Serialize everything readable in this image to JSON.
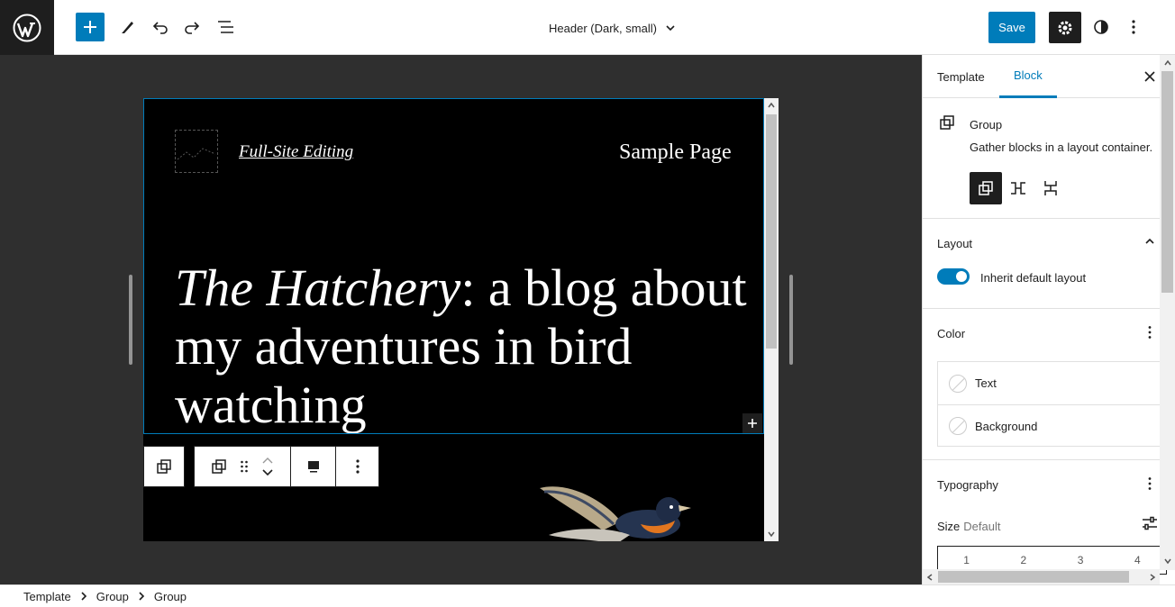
{
  "toolbar": {
    "document_title": "Header (Dark, small)",
    "save_label": "Save",
    "icons": [
      "wordpress-icon",
      "plus-icon",
      "pencil-icon",
      "undo-icon",
      "redo-icon",
      "list-view-icon",
      "chevron-down-icon",
      "gear-icon",
      "contrast-icon",
      "more-vertical-icon"
    ]
  },
  "canvas": {
    "site_title": "Full-Site Editing",
    "nav_link": "Sample Page",
    "headline_italic": "The Hatchery",
    "headline_rest": ": a blog about my adventures in bird watching"
  },
  "sidebar": {
    "tabs": [
      {
        "label": "Template"
      },
      {
        "label": "Block"
      }
    ],
    "block_title": "Group",
    "block_description": "Gather blocks in a layout container.",
    "layout_title": "Layout",
    "inherit_layout_label": "Inherit default layout",
    "color_title": "Color",
    "color_items": [
      {
        "label": "Text"
      },
      {
        "label": "Background"
      }
    ],
    "typography_title": "Typography",
    "size_label": "Size",
    "size_value": "Default",
    "size_options": [
      "1",
      "2",
      "3",
      "4"
    ]
  },
  "footer": {
    "breadcrumbs": [
      "Template",
      "Group",
      "Group"
    ]
  },
  "colors": {
    "accent": "#007cba",
    "dark": "#1e1e1e",
    "canvas_bg": "#2f2f2f"
  }
}
